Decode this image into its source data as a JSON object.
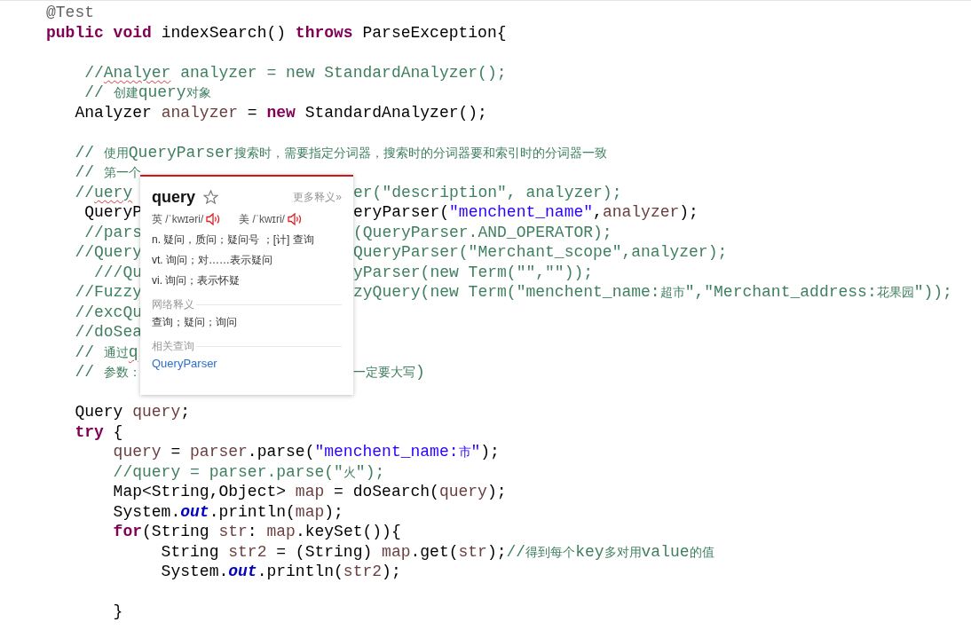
{
  "editor": {
    "lines": [
      {
        "left": [
          {
            "kind": "annotation",
            "text": "@Test"
          }
        ]
      },
      {
        "left": [
          {
            "kind": "keyword",
            "text": "public void"
          },
          {
            "kind": "plain",
            "text": " indexSearch() "
          },
          {
            "kind": "keyword",
            "text": "throws"
          },
          {
            "kind": "plain",
            "text": " ParseException{"
          }
        ]
      },
      {
        "blank_line_before": true,
        "left": [
          {
            "kind": "comment",
            "text": "    //"
          },
          {
            "kind": "comment",
            "text": "Analyer",
            "misspelled": true
          },
          {
            "kind": "comment",
            "text": " analyzer = new StandardAnalyzer();"
          }
        ]
      },
      {
        "left": [
          {
            "kind": "comment",
            "text": "    // 创建query对象"
          }
        ]
      },
      {
        "left": [
          {
            "kind": "plain",
            "text": "   Analyzer "
          },
          {
            "kind": "var",
            "text": "analyzer"
          },
          {
            "kind": "plain",
            "text": " = "
          },
          {
            "kind": "keyword",
            "text": "new"
          },
          {
            "kind": "plain",
            "text": " StandardAnalyzer();"
          }
        ]
      },
      {
        "blank_line_before": true,
        "left": [
          {
            "kind": "comment",
            "text": "   // 使用QueryParser搜索时，需要指定分词器，搜索时的分词器要和索引时的分词器一致"
          }
        ]
      },
      {
        "left": [
          {
            "kind": "comment",
            "text": "   // 第一个"
          }
        ]
      },
      {
        "left": [
          {
            "kind": "comment",
            "text": "   //"
          },
          {
            "kind": "comment",
            "text": "uery",
            "misspelled": true
          }
        ],
        "right": [
          {
            "kind": "comment",
            "text": "er(\"description\", analyzer);"
          }
        ]
      },
      {
        "left": [
          {
            "kind": "plain",
            "text": "    QueryP"
          }
        ],
        "right": [
          {
            "kind": "plain",
            "text": "eryParser("
          },
          {
            "kind": "string",
            "text": "\"menchent_name\""
          },
          {
            "kind": "plain",
            "text": ","
          },
          {
            "kind": "var",
            "text": "analyzer"
          },
          {
            "kind": "plain",
            "text": ");"
          }
        ]
      },
      {
        "left": [
          {
            "kind": "comment",
            "text": "    //pars"
          }
        ],
        "right": [
          {
            "kind": "comment",
            "text": "(QueryParser.AND_OPERATOR);"
          }
        ]
      },
      {
        "left": [
          {
            "kind": "comment",
            "text": "   //Query"
          }
        ],
        "right": [
          {
            "kind": "comment",
            "text": "QueryParser(\"Merchant_scope\",analyzer);"
          }
        ]
      },
      {
        "left": [
          {
            "kind": "comment",
            "text": "     ///Qu"
          }
        ],
        "right": [
          {
            "kind": "comment",
            "text": "yParser(new Term(\"\",\"\"));"
          }
        ]
      },
      {
        "left": [
          {
            "kind": "comment",
            "text": "   //Fuzzy"
          }
        ],
        "right": [
          {
            "kind": "comment",
            "text": "zyQuery(new Term(\"menchent_name:超市\",\"Merchant_address:花果园\"));"
          }
        ]
      },
      {
        "left": [
          {
            "kind": "comment",
            "text": "   //excQu"
          }
        ]
      },
      {
        "left": [
          {
            "kind": "comment",
            "text": "   //doSea"
          }
        ]
      },
      {
        "left": [
          {
            "kind": "comment",
            "text": "   // 通过"
          },
          {
            "kind": "comment",
            "text": "q",
            "misspelled": true
          }
        ]
      },
      {
        "left": [
          {
            "kind": "comment",
            "text": "   // 参数："
          }
        ],
        "right": [
          {
            "kind": "comment",
            "text": "一定要大写)"
          }
        ]
      },
      {
        "blank_line_before": true,
        "left": [
          {
            "kind": "plain",
            "text": "   Query "
          },
          {
            "kind": "var",
            "text": "query"
          },
          {
            "kind": "plain",
            "text": ";"
          }
        ]
      },
      {
        "left": [
          {
            "kind": "keyword",
            "text": "   try"
          },
          {
            "kind": "plain",
            "text": " {"
          }
        ]
      },
      {
        "left": [
          {
            "kind": "var",
            "text": "       query"
          },
          {
            "kind": "plain",
            "text": " = "
          },
          {
            "kind": "var",
            "text": "parser"
          },
          {
            "kind": "plain",
            "text": ".parse("
          },
          {
            "kind": "string",
            "text": "\"menchent_name:市\""
          },
          {
            "kind": "plain",
            "text": ");"
          }
        ]
      },
      {
        "left": [
          {
            "kind": "comment",
            "text": "       //query = parser.parse(\"火\");"
          }
        ]
      },
      {
        "left": [
          {
            "kind": "plain",
            "text": "       Map<String,Object> "
          },
          {
            "kind": "var",
            "text": "map"
          },
          {
            "kind": "plain",
            "text": " = doSearch("
          },
          {
            "kind": "var",
            "text": "query"
          },
          {
            "kind": "plain",
            "text": ");"
          }
        ]
      },
      {
        "left": [
          {
            "kind": "plain",
            "text": "       System."
          },
          {
            "kind": "field",
            "text": "out"
          },
          {
            "kind": "plain",
            "text": ".println("
          },
          {
            "kind": "var",
            "text": "map"
          },
          {
            "kind": "plain",
            "text": ");"
          }
        ]
      },
      {
        "left": [
          {
            "kind": "keyword",
            "text": "       for"
          },
          {
            "kind": "plain",
            "text": "(String "
          },
          {
            "kind": "var",
            "text": "str"
          },
          {
            "kind": "plain",
            "text": ": "
          },
          {
            "kind": "var",
            "text": "map"
          },
          {
            "kind": "plain",
            "text": ".keySet()){"
          }
        ]
      },
      {
        "left": [
          {
            "kind": "plain",
            "text": "            String "
          },
          {
            "kind": "var",
            "text": "str2"
          },
          {
            "kind": "plain",
            "text": " = (String) "
          },
          {
            "kind": "var",
            "text": "map"
          },
          {
            "kind": "plain",
            "text": ".get("
          },
          {
            "kind": "var",
            "text": "str"
          },
          {
            "kind": "plain",
            "text": ");"
          },
          {
            "kind": "comment",
            "text": "//得到每个key多对用value的值"
          }
        ]
      },
      {
        "left": [
          {
            "kind": "plain",
            "text": "            System."
          },
          {
            "kind": "field",
            "text": "out"
          },
          {
            "kind": "plain",
            "text": ".println("
          },
          {
            "kind": "var",
            "text": "str2"
          },
          {
            "kind": "plain",
            "text": ");"
          }
        ]
      },
      {
        "blank_line_before": true,
        "left": [
          {
            "kind": "plain",
            "text": "       }"
          }
        ]
      }
    ]
  },
  "dictionary_popup": {
    "word": "query",
    "more_link": "更多释义»",
    "pronunciations": [
      {
        "label": "英 /ˈkwɪəri/"
      },
      {
        "label": "美 /ˈkwɪri/"
      }
    ],
    "definitions": [
      "n. 疑问，质问；疑问号 ；[计] 查询",
      "vt. 询问；对……表示疑问",
      "vi. 询问；表示怀疑"
    ],
    "web_section": {
      "heading": "网络释义",
      "text": "查询；疑问；询问"
    },
    "related_section": {
      "heading": "相关查询",
      "links": [
        "QueryParser"
      ]
    }
  }
}
